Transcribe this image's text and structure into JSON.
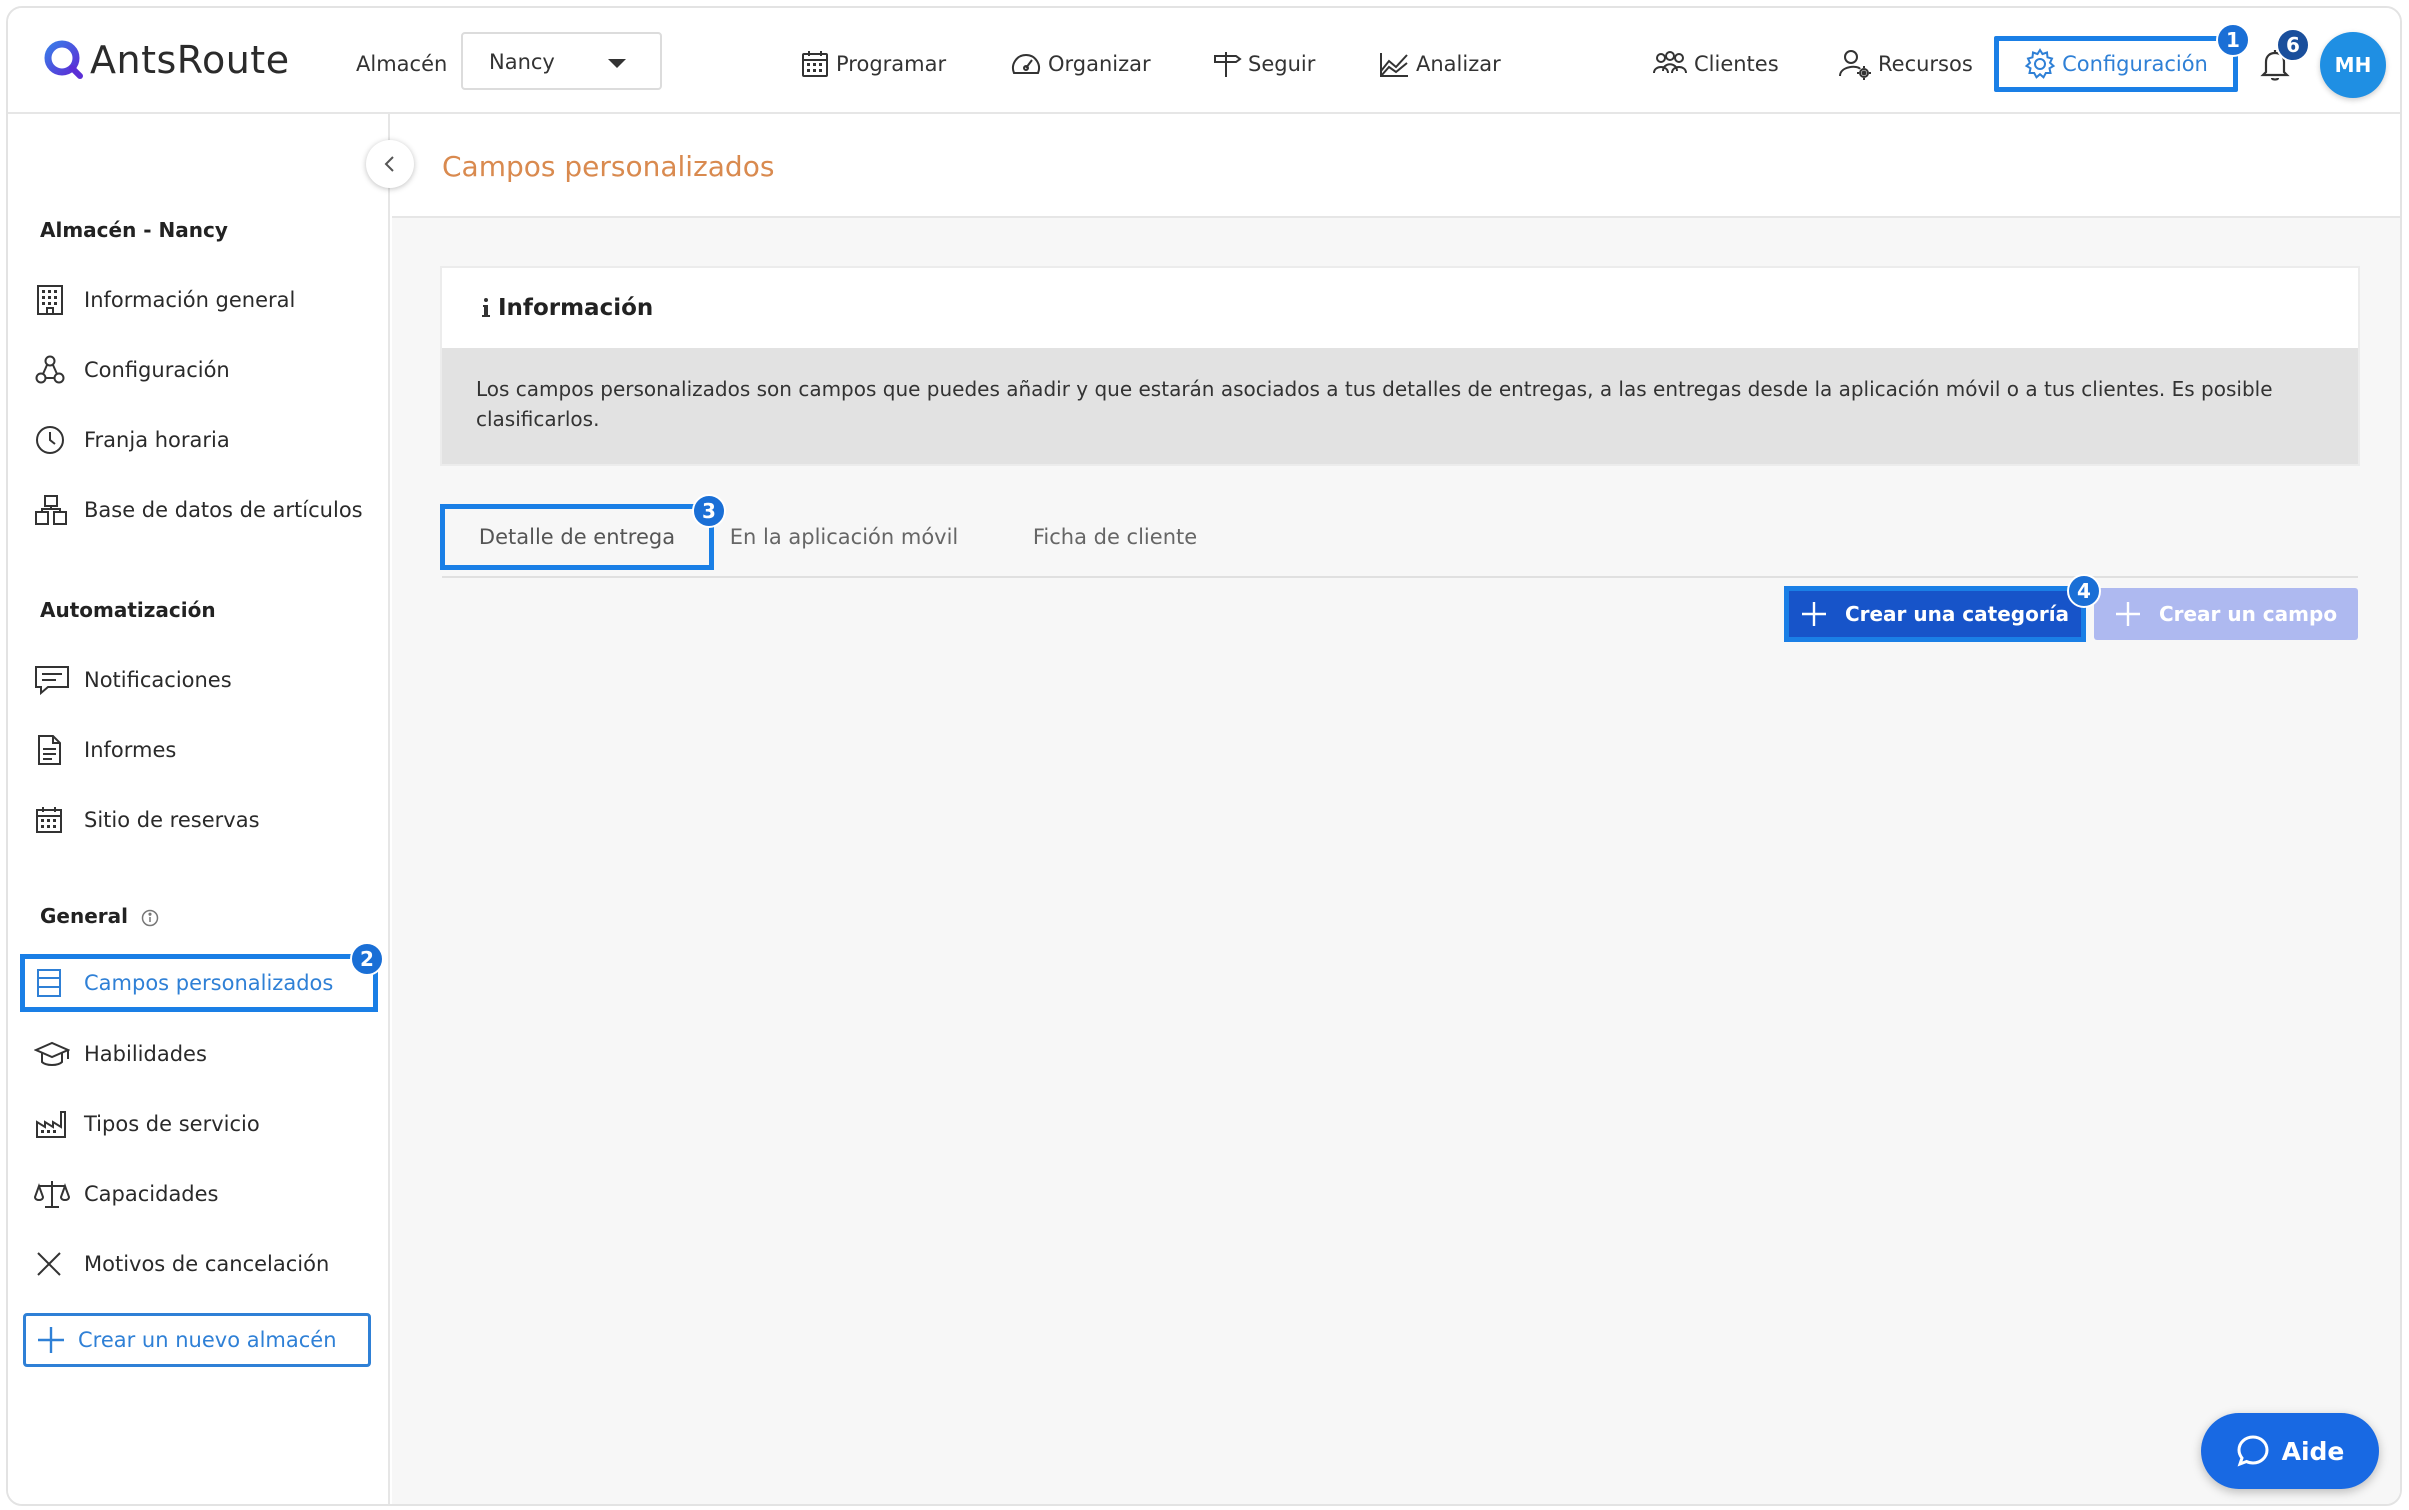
{
  "app": {
    "logo_text": "AntsRoute"
  },
  "topnav": {
    "warehouse_label": "Almacén",
    "warehouse_value": "Nancy",
    "items": [
      {
        "label": "Programar",
        "icon": "calendar-icon"
      },
      {
        "label": "Organizar",
        "icon": "speedometer-icon"
      },
      {
        "label": "Seguir",
        "icon": "signpost-icon"
      },
      {
        "label": "Analizar",
        "icon": "chart-icon"
      },
      {
        "label": "Clientes",
        "icon": "users-icon"
      },
      {
        "label": "Recursos",
        "icon": "user-gear-icon"
      }
    ],
    "config_label": "Configuración",
    "avatar_initials": "MH",
    "notification_count": "6"
  },
  "badges": {
    "b1": "1",
    "b2": "2",
    "b3": "3",
    "b4": "4"
  },
  "sidebar": {
    "section1": "Almacén - Nancy",
    "items1": [
      {
        "label": "Información general",
        "icon": "building-icon"
      },
      {
        "label": "Configuración",
        "icon": "nodes-icon"
      },
      {
        "label": "Franja horaria",
        "icon": "clock-icon"
      },
      {
        "label": "Base de datos de artículos",
        "icon": "boxes-icon"
      }
    ],
    "section2": "Automatización",
    "items2": [
      {
        "label": "Notificaciones",
        "icon": "message-icon"
      },
      {
        "label": "Informes",
        "icon": "document-icon"
      },
      {
        "label": "Sitio de reservas",
        "icon": "calendar-icon"
      }
    ],
    "section3": "General",
    "items3": [
      {
        "label": "Campos personalizados",
        "icon": "table-icon"
      },
      {
        "label": "Habilidades",
        "icon": "graduation-cap-icon"
      },
      {
        "label": "Tipos de servicio",
        "icon": "factory-icon"
      },
      {
        "label": "Capacidades",
        "icon": "scale-icon"
      },
      {
        "label": "Motivos de cancelación",
        "icon": "x-icon"
      }
    ],
    "create_warehouse": "Crear un nuevo almacén"
  },
  "main": {
    "page_title": "Campos personalizados",
    "info_title": "Información",
    "info_text": "Los campos personalizados son campos que puedes añadir y que estarán asociados a tus detalles de entregas, a las entregas desde la aplicación móvil o a tus clientes. Es posible clasificarlos.",
    "tabs": [
      {
        "label": "Detalle de entrega"
      },
      {
        "label": "En la aplicación móvil"
      },
      {
        "label": "Ficha de cliente"
      }
    ],
    "create_category": "Crear una categoría",
    "create_field": "Crear un campo"
  },
  "help": {
    "label": "Aide"
  },
  "colors": {
    "accent": "#2f80d6",
    "highlight": "#1a7fe6",
    "primary_button": "#1754c9",
    "disabled_button": "#aeb9f0",
    "title_orange": "#d98a4f"
  }
}
